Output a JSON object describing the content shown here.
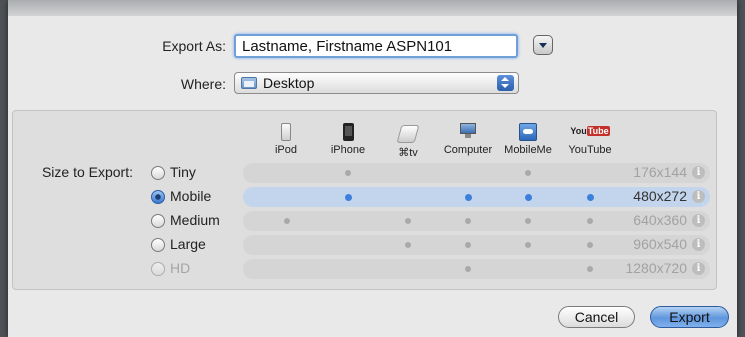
{
  "form": {
    "export_as_label": "Export As:",
    "export_as_value": "Lastname, Firstname ASPN101",
    "where_label": "Where:",
    "where_value": "Desktop"
  },
  "size_to_export_label": "Size to Export:",
  "devices": [
    {
      "label": "iPod",
      "icon": "ipod-icon"
    },
    {
      "label": "iPhone",
      "icon": "iphone-icon"
    },
    {
      "label": "⌘tv",
      "icon": "appletv-icon"
    },
    {
      "label": "Computer",
      "icon": "computer-icon"
    },
    {
      "label": "MobileMe",
      "icon": "mobileme-icon"
    },
    {
      "label": "YouTube",
      "icon": "youtube-icon"
    }
  ],
  "sizes": [
    {
      "label": "Tiny",
      "resolution": "176x144",
      "selected": false,
      "enabled": true,
      "devices": [
        false,
        true,
        false,
        false,
        true,
        false
      ]
    },
    {
      "label": "Mobile",
      "resolution": "480x272",
      "selected": true,
      "enabled": true,
      "devices": [
        false,
        true,
        false,
        true,
        true,
        true
      ]
    },
    {
      "label": "Medium",
      "resolution": "640x360",
      "selected": false,
      "enabled": true,
      "devices": [
        true,
        false,
        true,
        true,
        true,
        true
      ]
    },
    {
      "label": "Large",
      "resolution": "960x540",
      "selected": false,
      "enabled": true,
      "devices": [
        false,
        false,
        true,
        true,
        true,
        true
      ]
    },
    {
      "label": "HD",
      "resolution": "1280x720",
      "selected": false,
      "enabled": false,
      "devices": [
        false,
        false,
        false,
        true,
        false,
        true
      ]
    }
  ],
  "buttons": {
    "cancel": "Cancel",
    "export": "Export"
  },
  "colors": {
    "accent": "#3d7fdc",
    "selected_row": "#c3d5ec"
  }
}
